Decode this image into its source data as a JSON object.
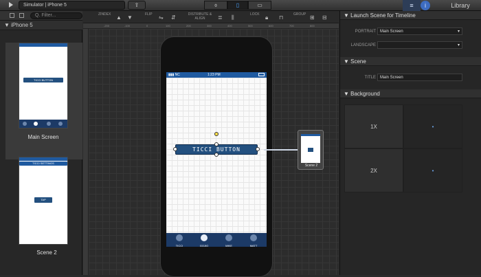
{
  "topbar": {
    "breadcrumb": "Simulator  |  iPhone 5",
    "share_glyph": "⇪",
    "device_tabs": [
      "⌽",
      "▯",
      "▭"
    ],
    "library_label": "Library",
    "list_glyph": "≡",
    "info_glyph": "i",
    "accent_color": "#4aa3ff"
  },
  "left": {
    "filter_placeholder": "Q. Filter...",
    "group_label": "▼  iPhone 5",
    "scenes": [
      {
        "label": "Main Screen",
        "button_text": "TICCI BUTTON"
      },
      {
        "label": "Scene 2",
        "button_text": "TAP",
        "header_text": "TICCI SETTINGS"
      }
    ]
  },
  "canvas": {
    "tool_labels": [
      "ZINDEX",
      "FLIP",
      "DISTRIBUTE & ALIGN",
      "LOCK",
      "GROUP"
    ],
    "ruler_ticks": [
      "-200",
      "-100",
      "0",
      "100",
      "200",
      "300",
      "400",
      "500",
      "600",
      "700",
      "800"
    ],
    "status_time": "1:23 PM",
    "status_carrier": "▮▮▮ NC",
    "button_text": "TICCI BUTTON",
    "tabs": [
      "TICCI",
      "GOJIO",
      "MIKE",
      "MATT"
    ],
    "selected_tab": 1,
    "mini_scene_label": "Scene 2"
  },
  "inspector": {
    "launch_section": "Launch Scene for Timeline",
    "portrait_label": "PORTRAIT",
    "portrait_value": "Main Screen",
    "landscape_label": "LANDSCAPE",
    "landscape_value": "",
    "scene_section": "Scene",
    "title_label": "TITLE",
    "title_value": "Main Screen",
    "background_section": "Background",
    "bg_rows": [
      "1X",
      "2X"
    ]
  }
}
